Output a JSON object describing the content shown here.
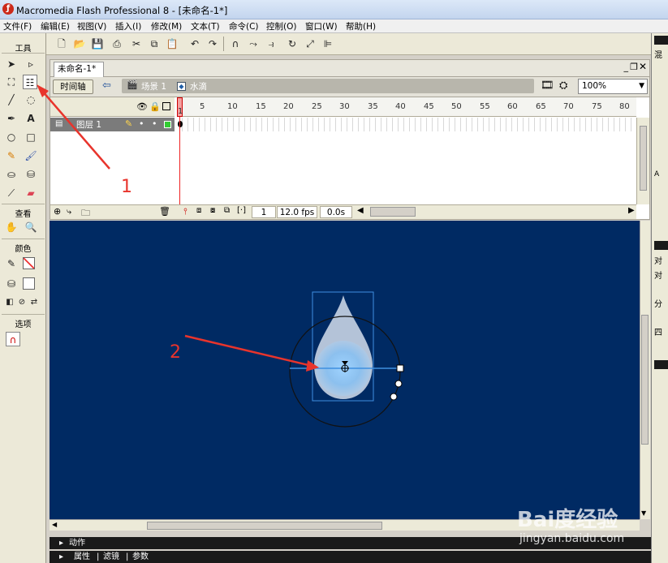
{
  "window": {
    "title": "Macromedia Flash Professional 8 - [未命名-1*]"
  },
  "menu": [
    "文件(F)",
    "编辑(E)",
    "视图(V)",
    "插入(I)",
    "修改(M)",
    "文本(T)",
    "命令(C)",
    "控制(O)",
    "窗口(W)",
    "帮助(H)"
  ],
  "tools_panel": {
    "title": "工具",
    "view_label": "查看",
    "color_label": "颜色",
    "options_label": "选项",
    "selected_tool": "free-transform-tool"
  },
  "document": {
    "tab": "未命名-1*",
    "timeline_button": "时间轴",
    "scene": "场景 1",
    "symbol": "水滴",
    "zoom": "100%"
  },
  "timeline": {
    "layer_name": "图层 1",
    "frame_ticks": [
      "1",
      "5",
      "10",
      "15",
      "20",
      "25",
      "30",
      "35",
      "40",
      "45",
      "50",
      "55",
      "60",
      "65",
      "70",
      "75",
      "80"
    ],
    "current_frame": "1",
    "fps": "12.0 fps",
    "time": "0.0s"
  },
  "panels": {
    "actions": "动作",
    "properties": [
      "属性",
      "滤镜",
      "参数"
    ]
  },
  "right_panel": {
    "items": [
      "混",
      "对",
      "对",
      "分",
      "四"
    ],
    "partial_label": "A"
  },
  "annotations": {
    "label_1": "1",
    "label_2": "2",
    "color": "#e8342c"
  },
  "watermark": {
    "logo": "Bai度经验",
    "url": "jingyan.baidu.com"
  },
  "stage": {
    "background": "#002a63"
  }
}
